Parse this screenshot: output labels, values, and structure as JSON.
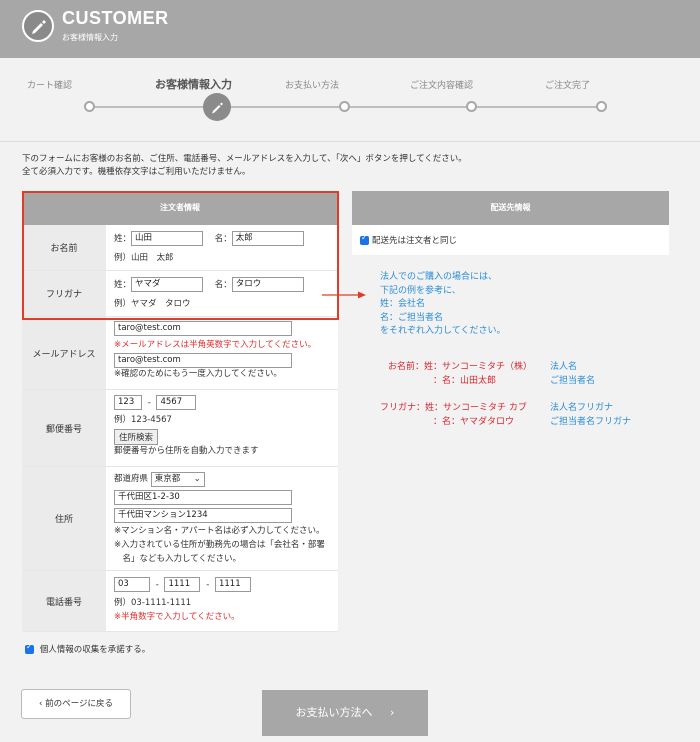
{
  "header": {
    "title": "CUSTOMER",
    "subtitle": "お客様情報入力",
    "icon": "pen-icon"
  },
  "steps": [
    {
      "label": "カート確認",
      "active": false
    },
    {
      "label": "お客様情報入力",
      "active": true
    },
    {
      "label": "お支払い方法",
      "active": false
    },
    {
      "label": "ご注文内容確認",
      "active": false
    },
    {
      "label": "ご注文完了",
      "active": false
    }
  ],
  "intro": {
    "line1": "下のフォームにお客様のお名前、ご住所、電話番号、メールアドレスを入力して、「次へ」ボタンを押してください。",
    "line2": "全て必須入力です。機種依存文字はご利用いただけません。"
  },
  "orderer": {
    "heading": "注文者情報",
    "name": {
      "label": "お名前",
      "sei_label": "姓：",
      "sei_value": "山田",
      "mei_label": "名：",
      "mei_value": "太郎",
      "example": "例）山田　太郎"
    },
    "furigana": {
      "label": "フリガナ",
      "sei_label": "姓：",
      "sei_value": "ヤマダ",
      "mei_label": "名：",
      "mei_value": "タロウ",
      "example": "例）ヤマダ　タロウ"
    },
    "email": {
      "label": "メールアドレス",
      "value": "taro@test.com",
      "warning": "※メールアドレスは半角英数字で入力してください。",
      "confirm_value": "taro@test.com",
      "confirm_note": "※確認のためにもう一度入力してください。"
    },
    "postal": {
      "label": "郵便番号",
      "part1": "123",
      "sep": "-",
      "part2": "4567",
      "example": "例）123-4567",
      "search_button": "住所検索",
      "search_note": "郵便番号から住所を自動入力できます"
    },
    "address": {
      "label": "住所",
      "pref_label": "都道府県",
      "pref_value": "東京都",
      "line1": "千代田区1-2-30",
      "line2": "千代田マンション1234",
      "note1": "※マンション名・アパート名は必ず入力してください。",
      "note2": "※入力されている住所が勤務先の場合は「会社名・部署",
      "note3": "　名」なども入力してください。"
    },
    "phone": {
      "label": "電話番号",
      "part1": "03",
      "sep1": "-",
      "part2": "1111",
      "sep2": "-",
      "part3": "1111",
      "example": "例）03-1111-1111",
      "warning": "※半角数字で入力してください。"
    }
  },
  "shipping": {
    "heading": "配送先情報",
    "same_as_orderer": "配送先は注文者と同じ"
  },
  "hint": {
    "lines": [
      "法人でのご購入の場合には、",
      "下記の例を参考に、",
      "姓：会社名",
      "名：ご担当者名",
      "をそれぞれ入力してください。"
    ]
  },
  "examples": {
    "name_line1": "お名前：姓：サンコーミタチ（株）",
    "name_line2": "：名：山田太郎",
    "name_tag1": "法人名",
    "name_tag2": "ご担当者名",
    "kana_line1": "フリガナ：姓：サンコーミタチ カブ",
    "kana_line2": "：名：ヤマダタロウ",
    "kana_tag1": "法人名フリガナ",
    "kana_tag2": "ご担当者名フリガナ"
  },
  "consent": {
    "label": "個人情報の収集を承諾する。",
    "checked": true
  },
  "buttons": {
    "back": "前のページに戻る",
    "next": "お支払い方法へ"
  },
  "colors": {
    "header_bg": "#a7a7a7",
    "highlight": "#e03c2a",
    "warning": "#e02d2d",
    "hint": "#2a8dd8"
  }
}
